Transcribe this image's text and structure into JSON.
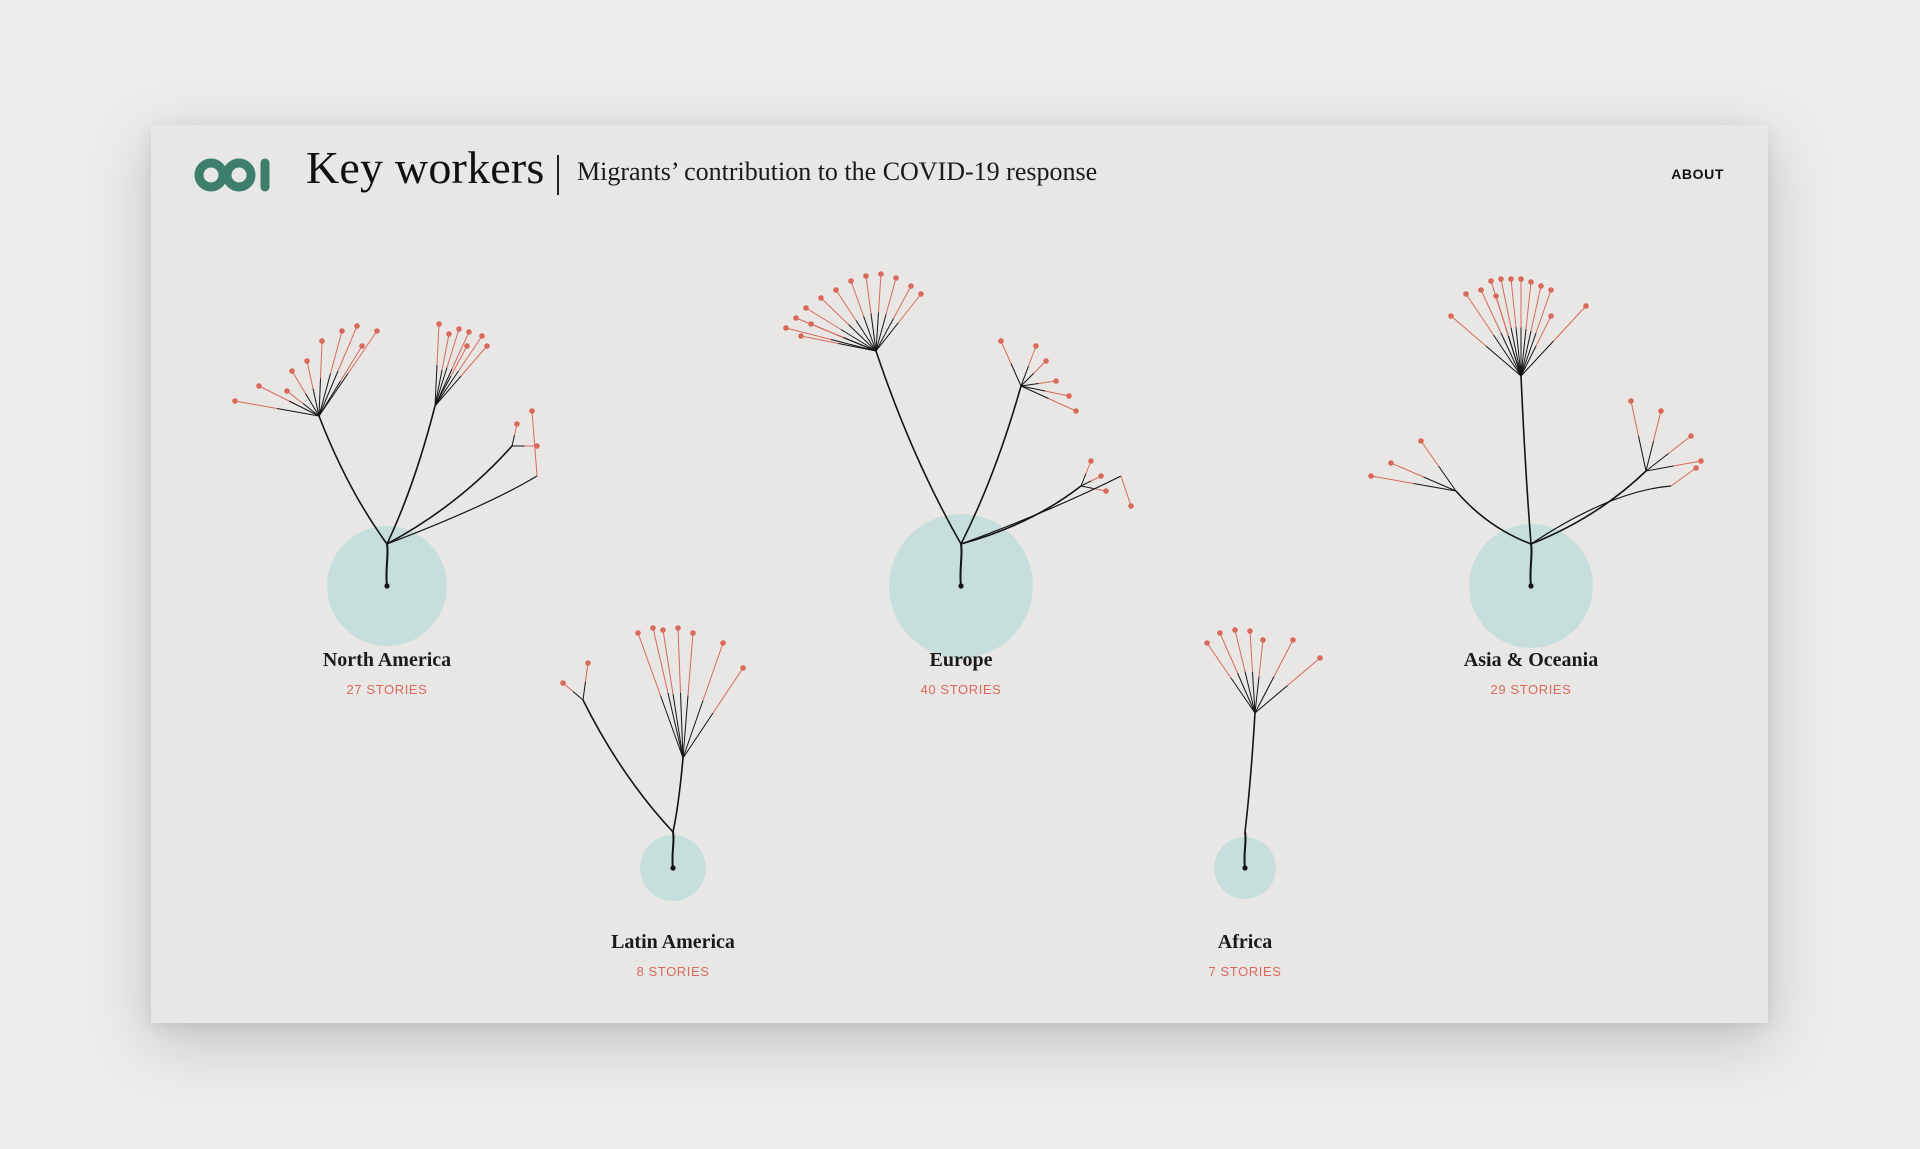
{
  "header": {
    "title": "Key workers",
    "subtitle": "Migrants’ contribution to the COVID-19 response",
    "about_label": "ABOUT",
    "logo_icon": "odi-logo-icon"
  },
  "colors": {
    "brand": "#3d7f6c",
    "stem": "#141414",
    "story": "#d96a5a",
    "circle": "#c7dfdc",
    "page": "#e8e7e6"
  },
  "chart_data": {
    "type": "tree",
    "regions": [
      {
        "name": "North America",
        "count_label": "27 STORIES",
        "stories": 27
      },
      {
        "name": "Europe",
        "count_label": "40 STORIES",
        "stories": 40
      },
      {
        "name": "Asia & Oceania",
        "count_label": "29 STORIES",
        "stories": 29
      },
      {
        "name": "Latin America",
        "count_label": "8 STORIES",
        "stories": 8
      },
      {
        "name": "Africa",
        "count_label": "7 STORIES",
        "stories": 7
      }
    ]
  }
}
